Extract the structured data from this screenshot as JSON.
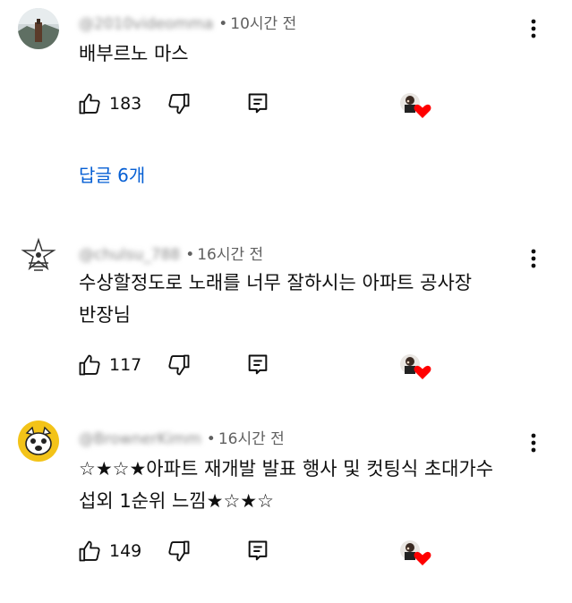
{
  "comments": [
    {
      "handle": "@2010videomma",
      "separator": "•",
      "time": "10시간 전",
      "lines": [
        "배부르노 마스"
      ],
      "likes": "183",
      "replies_label": "답글 6개"
    },
    {
      "handle": "@chulsu_788",
      "separator": "•",
      "time": "16시간 전",
      "lines": [
        "수상할정도로 노래를 너무 잘하시는 아파트 공사장",
        "반장님"
      ],
      "likes": "117"
    },
    {
      "handle": "@BrownerKimm",
      "separator": "•",
      "time": "16시간 전",
      "lines": [
        "☆★☆★아파트 재개발 발표 행사 및 컷팅식 초대가수",
        "섭외 1순위 느낌★☆★☆"
      ],
      "likes": "149"
    }
  ],
  "colors": {
    "link": "#065fd4",
    "heart": "#ff0000",
    "meta": "#606060",
    "text": "#0f0f0f"
  },
  "icons": [
    "thumbs-up-icon",
    "thumbs-down-icon",
    "reply-icon",
    "creator-heart-icon",
    "more-vert-icon"
  ]
}
